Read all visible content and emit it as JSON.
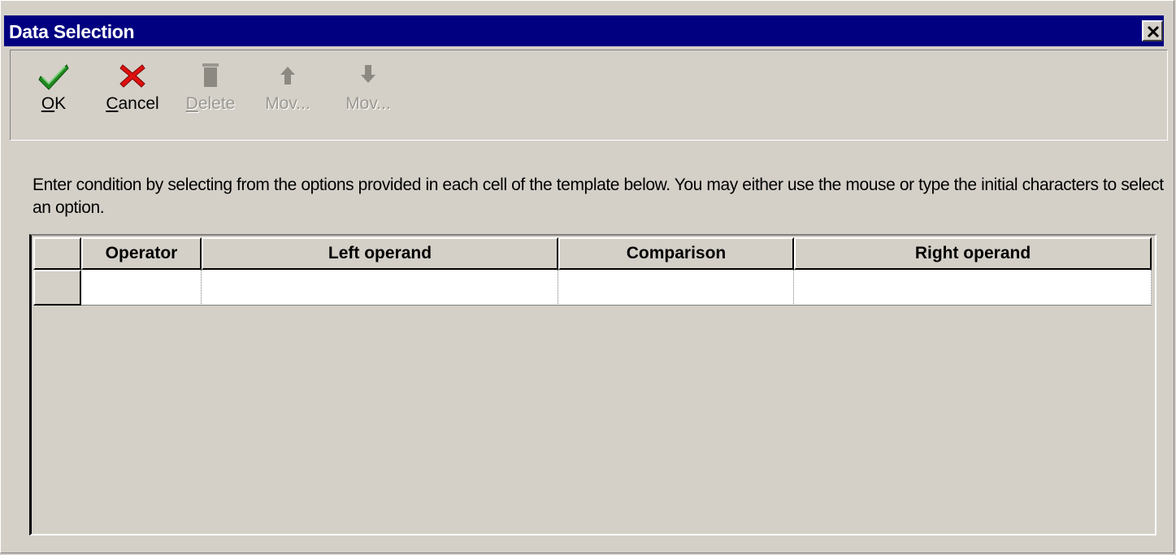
{
  "window": {
    "title": "Data Selection",
    "close_label": "Close"
  },
  "toolbar": {
    "ok": {
      "accel": "O",
      "rest": "K",
      "icon": "checkmark-icon",
      "enabled": true
    },
    "cancel": {
      "accel": "C",
      "rest": "ancel",
      "icon": "red-x-icon",
      "enabled": true
    },
    "delete": {
      "accel": "D",
      "rest": "elete",
      "icon": "trash-icon",
      "enabled": false
    },
    "move_up": {
      "label": "Mov...",
      "icon": "move-up-arrow-icon",
      "enabled": false
    },
    "move_down": {
      "label": "Mov...",
      "icon": "move-down-arrow-icon",
      "enabled": false
    }
  },
  "instructions": "Enter condition by selecting from the options provided in each cell of the template below. You may either use the mouse or type the initial characters to select an option.",
  "grid": {
    "columns": [
      "Operator",
      "Left operand",
      "Comparison",
      "Right operand"
    ],
    "rows": [
      {
        "operator": "",
        "left_operand": "",
        "comparison": "",
        "right_operand": ""
      }
    ]
  },
  "colors": {
    "title_bar": "#000080",
    "face": "#d4d0c8",
    "ok_green": "#1e8c1e",
    "cancel_red": "#e01010",
    "disabled_gray": "#9a9790"
  }
}
